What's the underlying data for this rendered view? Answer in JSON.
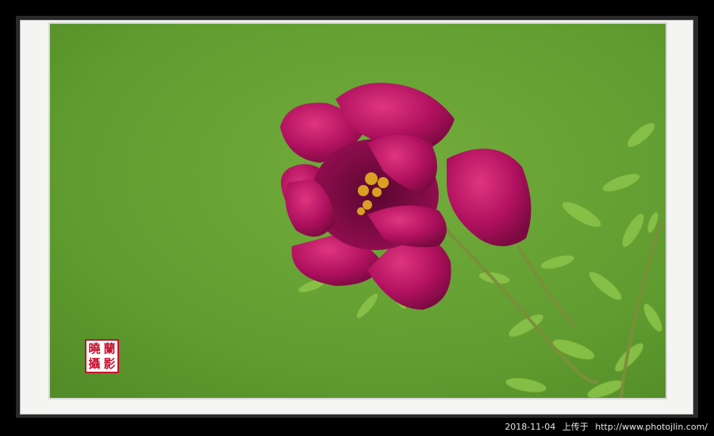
{
  "photo": {
    "subject": "magenta peony flower with green leaves",
    "background_color": "#5f9b2f",
    "petal_color": "#b0115f"
  },
  "seal": {
    "glyphs": [
      "曉",
      "蘭",
      "攝",
      "影"
    ],
    "color": "#c8102e"
  },
  "caption": {
    "date": "2018-11-04",
    "action": "上传于",
    "url": "http://www.photojlin.com/"
  }
}
